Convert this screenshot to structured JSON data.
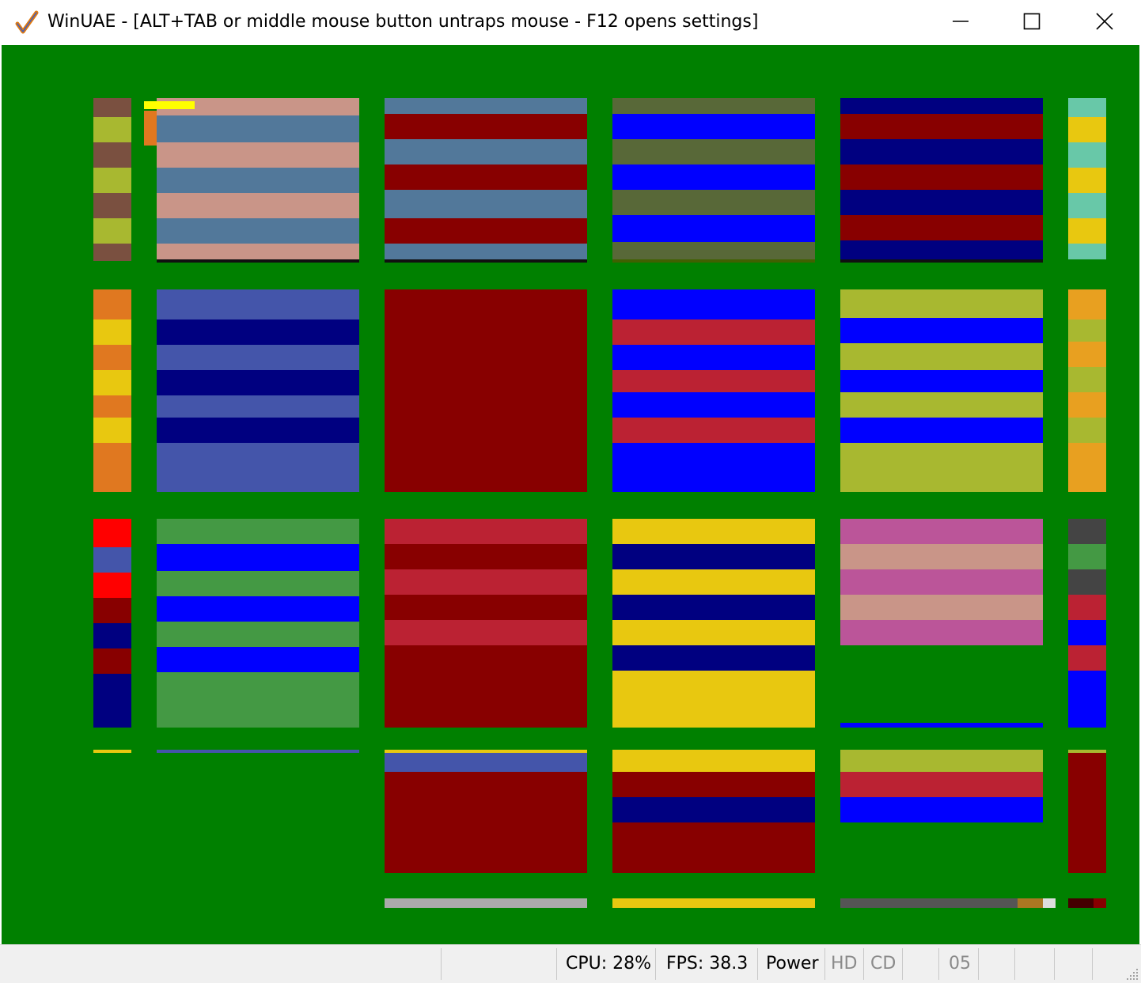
{
  "window": {
    "title": "WinUAE - [ALT+TAB or middle mouse button untraps mouse - F12 opens settings]",
    "controls": [
      "minimize",
      "maximize",
      "close"
    ]
  },
  "display": {
    "background_color": "#008000",
    "content": "emulated Amiga screen showing colored stripe pattern"
  },
  "statusbar": {
    "cpu": "CPU: 28%",
    "fps": "FPS: 38.3",
    "power": "Power",
    "hd": "HD",
    "cd": "CD",
    "drive": "05"
  },
  "icons": {
    "app": "winuae-checkmark-icon",
    "minimize": "minimize-icon",
    "maximize": "maximize-icon",
    "close": "close-icon",
    "grip": "resize-grip-icon"
  }
}
